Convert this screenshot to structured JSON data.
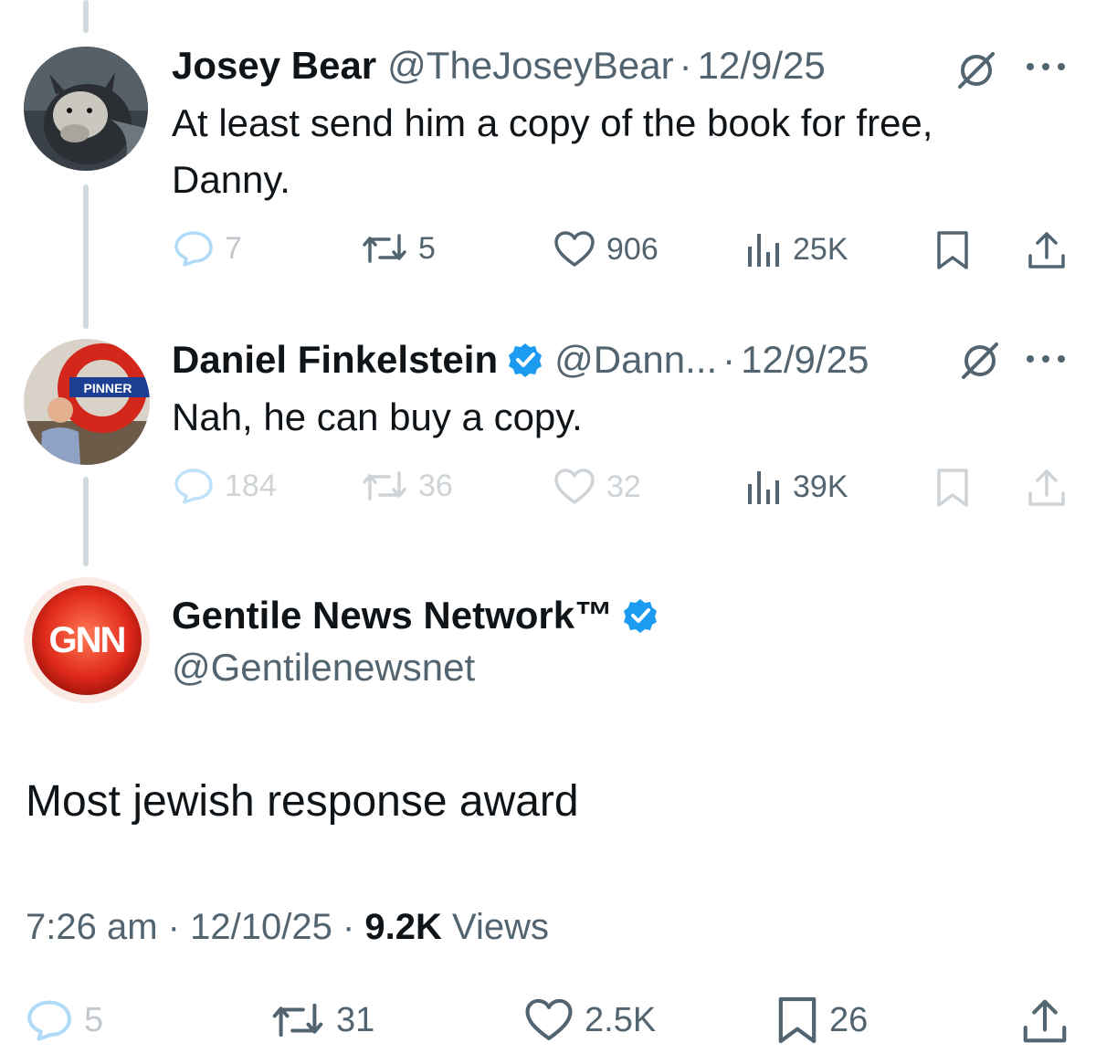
{
  "tweet1": {
    "name": "Josey Bear",
    "handle": "@TheJoseyBear",
    "separator": "·",
    "date": "12/9/25",
    "text_line1": "At least send him a copy of the book for free,",
    "text_line2": "Danny.",
    "replies": "7",
    "reposts": "5",
    "likes": "906",
    "views": "25K"
  },
  "tweet2": {
    "name": "Daniel Finkelstein",
    "handle": "@Dann...",
    "separator": "·",
    "date": "12/9/25",
    "text": "Nah, he can buy a copy.",
    "avatar_sign_text": "PINNER",
    "replies": "184",
    "reposts": "36",
    "likes": "32",
    "views": "39K"
  },
  "main": {
    "name": "Gentile News Network™",
    "handle": "@Gentilenewsnet",
    "logo_text": "GNN",
    "text": "Most jewish response award",
    "time": "7:26 am",
    "separator": "·",
    "date": "12/10/25",
    "views_count": "9.2K",
    "views_label": "Views",
    "replies": "5",
    "reposts": "31",
    "likes": "2.5K",
    "bookmarks": "26"
  },
  "colors": {
    "verified": "#1d9bf0",
    "secondary_text": "#536471",
    "thread_line": "#cfd9de",
    "gnn_red": "#e02a1b"
  },
  "icons": [
    "no-entry-icon",
    "more-icon",
    "reply-icon",
    "repost-icon",
    "like-icon",
    "views-icon",
    "bookmark-icon",
    "share-icon",
    "verified-badge-icon"
  ]
}
